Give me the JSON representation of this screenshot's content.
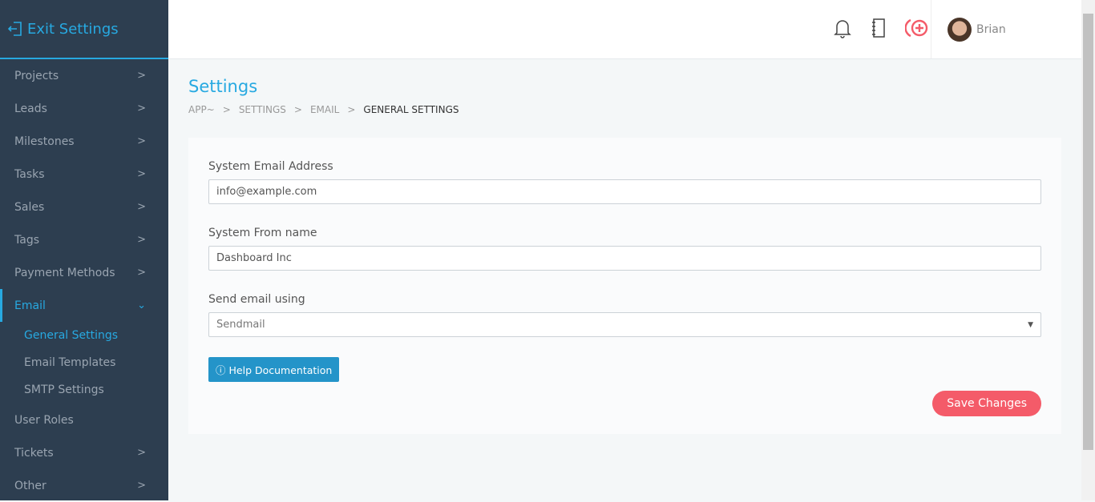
{
  "sidebar": {
    "exit_label": "Exit Settings",
    "items": [
      {
        "label": "Projects"
      },
      {
        "label": "Leads"
      },
      {
        "label": "Milestones"
      },
      {
        "label": "Tasks"
      },
      {
        "label": "Sales"
      },
      {
        "label": "Tags"
      },
      {
        "label": "Payment Methods"
      },
      {
        "label": "Email"
      }
    ],
    "email_sub": [
      {
        "label": "General Settings"
      },
      {
        "label": "Email Templates"
      },
      {
        "label": "SMTP Settings"
      }
    ],
    "after": [
      {
        "label": "User Roles"
      },
      {
        "label": "Tickets"
      },
      {
        "label": "Other"
      }
    ]
  },
  "header": {
    "user": "Brian",
    "accent": "#f45b69"
  },
  "page": {
    "title": "Settings",
    "breadcrumb": [
      "APP~",
      "SETTINGS",
      "EMAIL",
      "GENERAL SETTINGS"
    ]
  },
  "form": {
    "email_label": "System Email Address",
    "email_value": "info@example.com",
    "from_label": "System From name",
    "from_value": "Dashboard Inc",
    "send_label": "Send email using",
    "send_value": "Sendmail",
    "help": "Help Documentation",
    "save": "Save Changes"
  }
}
